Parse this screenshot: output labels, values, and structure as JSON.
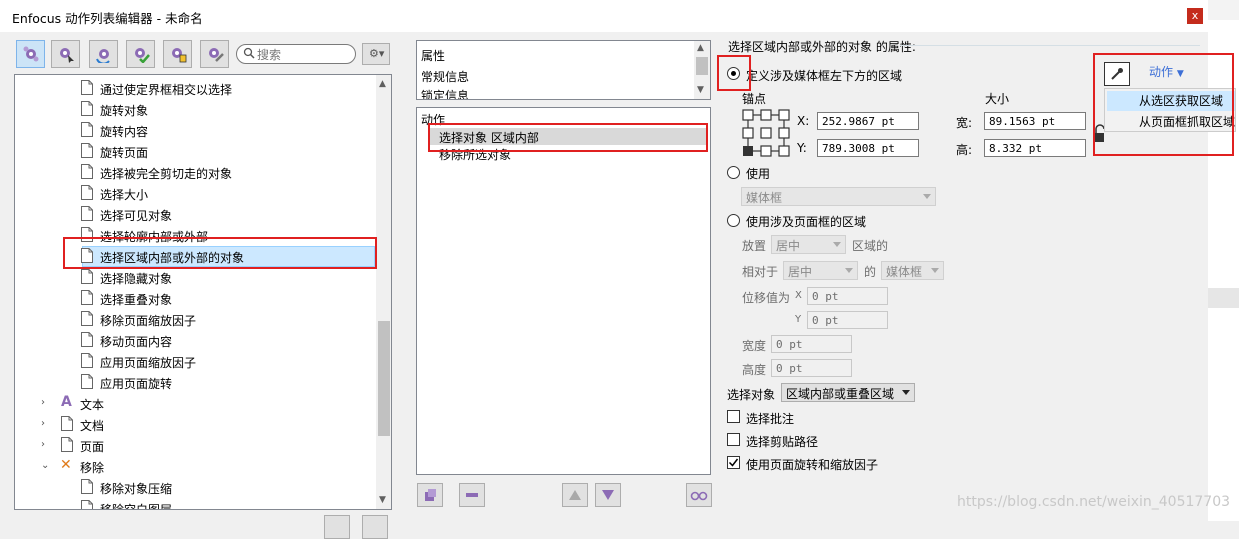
{
  "window": {
    "title": "Enfocus 动作列表编辑器 - 未命名",
    "close": "x"
  },
  "toolbar": {
    "buttons": [
      {
        "icon": "gear-cluster-icon"
      },
      {
        "icon": "gear-cursor-icon"
      },
      {
        "icon": "gear-cycle-icon"
      },
      {
        "icon": "gear-check-icon"
      },
      {
        "icon": "gear-info-icon"
      },
      {
        "icon": "gear-wrench-icon"
      }
    ],
    "search_placeholder": "搜索",
    "menu_glyph": "⚙▾"
  },
  "tree": {
    "items": [
      {
        "label": "通过使定界框相交以选择",
        "kind": "doc"
      },
      {
        "label": "旋转对象",
        "kind": "doc"
      },
      {
        "label": "旋转内容",
        "kind": "doc"
      },
      {
        "label": "旋转页面",
        "kind": "doc"
      },
      {
        "label": "选择被完全剪切走的对象",
        "kind": "doc"
      },
      {
        "label": "选择大小",
        "kind": "doc"
      },
      {
        "label": "选择可见对象",
        "kind": "doc"
      },
      {
        "label": "选择轮廓内部或外部",
        "kind": "doc"
      },
      {
        "label": "选择区域内部或外部的对象",
        "kind": "doc",
        "selected": true
      },
      {
        "label": "选择隐藏对象",
        "kind": "doc"
      },
      {
        "label": "选择重叠对象",
        "kind": "doc"
      },
      {
        "label": "移除页面缩放因子",
        "kind": "doc"
      },
      {
        "label": "移动页面内容",
        "kind": "doc"
      },
      {
        "label": "应用页面缩放因子",
        "kind": "doc"
      },
      {
        "label": "应用页面旋转",
        "kind": "doc"
      }
    ],
    "categories": [
      {
        "label": "文本",
        "icon": "text-a-icon",
        "arrow": "›"
      },
      {
        "label": "文档",
        "icon": "document-icon",
        "arrow": "›"
      },
      {
        "label": "页面",
        "icon": "page-icon",
        "arrow": "›"
      },
      {
        "label": "移除",
        "icon": "remove-x-icon",
        "arrow": "⌄"
      }
    ],
    "sub_items": [
      {
        "label": "移除对象压缩"
      },
      {
        "label": "移除空白图层"
      }
    ]
  },
  "properties_panel": {
    "items": [
      "属性",
      "常规信息",
      "锁定信息"
    ]
  },
  "actions_panel": {
    "header": "动作",
    "items": [
      "选择对象 区域内部",
      "移除所选对象"
    ]
  },
  "right_panel": {
    "title": "选择区域内部或外部的对象 的属性:",
    "option_define": "定义涉及媒体框左下方的区域",
    "anchor_label": "锚点",
    "size_label": "大小",
    "x_label": "X:",
    "x_value": "252.9867 pt",
    "y_label": "Y:",
    "y_value": "789.3008 pt",
    "width_label": "宽:",
    "width_value": "89.1563 pt",
    "height_label": "高:",
    "height_value": "8.332 pt",
    "option_use": "使用",
    "use_box": "媒体框",
    "option_page_area": "使用涉及页面框的区域",
    "place_label": "放置",
    "place_value": "居中",
    "area_suffix": "区域的",
    "relative_label": "相对于",
    "relative_value": "居中",
    "of_label": "的",
    "of_value": "媒体框",
    "offset_label": "位移值为",
    "offset_x_label": "X",
    "offset_x_value": "0 pt",
    "offset_y_label": "Y",
    "offset_y_value": "0 pt",
    "w_label": "宽度",
    "w_value": "0 pt",
    "h_label": "高度",
    "h_value": "0 pt",
    "select_obj_label": "选择对象",
    "select_obj_value": "区域内部或重叠区域",
    "chk_annotations": "选择批注",
    "chk_clip": "选择剪贴路径",
    "chk_rotate": "使用页面旋转和缩放因子",
    "chk_rotate_checked": true,
    "actions_menu": "动作"
  },
  "popup": {
    "items": [
      "从选区获取区域",
      "从页面框抓取区域"
    ]
  },
  "watermark": "https://blog.csdn.net/weixin_40517703",
  "colors": {
    "highlight_box": "#e02020",
    "selection": "#cce8ff",
    "link": "#3d6fd6"
  }
}
